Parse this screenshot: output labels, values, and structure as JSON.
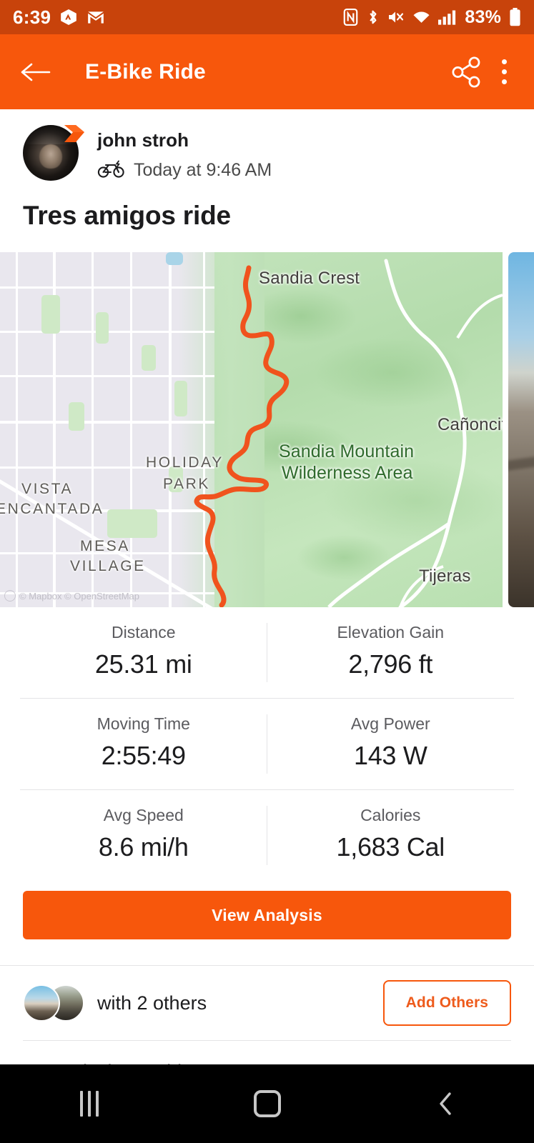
{
  "status_bar": {
    "time": "6:39",
    "battery_percent": "83%",
    "icons": [
      "strava-notification-icon",
      "gmail-icon",
      "nfc-icon",
      "bluetooth-icon",
      "mute-icon",
      "wifi-icon",
      "cellular-signal-icon",
      "battery-icon"
    ]
  },
  "app_bar": {
    "title": "E-Bike Ride",
    "back_icon": "back-arrow-icon",
    "share_icon": "share-icon",
    "overflow_icon": "kebab-menu-icon",
    "background_color": "#f7570c"
  },
  "athlete": {
    "name": "john stroh",
    "timestamp": "Today at 9:46 AM",
    "activity_type_icon": "e-bike-icon",
    "badge": "subscriber-chevron-badge"
  },
  "activity": {
    "title": "Tres amigos ride"
  },
  "map": {
    "attribution": "© Mapbox © OpenStreetMap",
    "route_color": "#f0531d",
    "labels": [
      {
        "text": "Sandia Crest",
        "type": "place"
      },
      {
        "text": "Cañoncito",
        "type": "place"
      },
      {
        "text": "Tijeras",
        "type": "place"
      },
      {
        "text": "Sandia Mountain",
        "type": "forest"
      },
      {
        "text": "Wilderness Area",
        "type": "forest"
      },
      {
        "text": "HOLIDAY",
        "type": "neighborhood"
      },
      {
        "text": "PARK",
        "type": "neighborhood"
      },
      {
        "text": "VISTA",
        "type": "neighborhood"
      },
      {
        "text": "ENCANTADA",
        "type": "neighborhood"
      },
      {
        "text": "MESA",
        "type": "neighborhood"
      },
      {
        "text": "VILLAGE",
        "type": "neighborhood"
      }
    ]
  },
  "stats": [
    [
      {
        "label": "Distance",
        "value": "25.31 mi"
      },
      {
        "label": "Elevation Gain",
        "value": "2,796 ft"
      }
    ],
    [
      {
        "label": "Moving Time",
        "value": "2:55:49"
      },
      {
        "label": "Avg Power",
        "value": "143 W"
      }
    ],
    [
      {
        "label": "Avg Speed",
        "value": "8.6 mi/h"
      },
      {
        "label": "Calories",
        "value": "1,683 Cal"
      }
    ]
  ],
  "cta": {
    "view_analysis_label": "View Analysis"
  },
  "others": {
    "text": "with 2 others",
    "add_button_label": "Add Others"
  },
  "gear": {
    "name": "Black Sunshine",
    "icon": "bike-gear-icon"
  },
  "nav_bar": {
    "recent_label": "recent-apps",
    "home_label": "home",
    "back_label": "back"
  }
}
